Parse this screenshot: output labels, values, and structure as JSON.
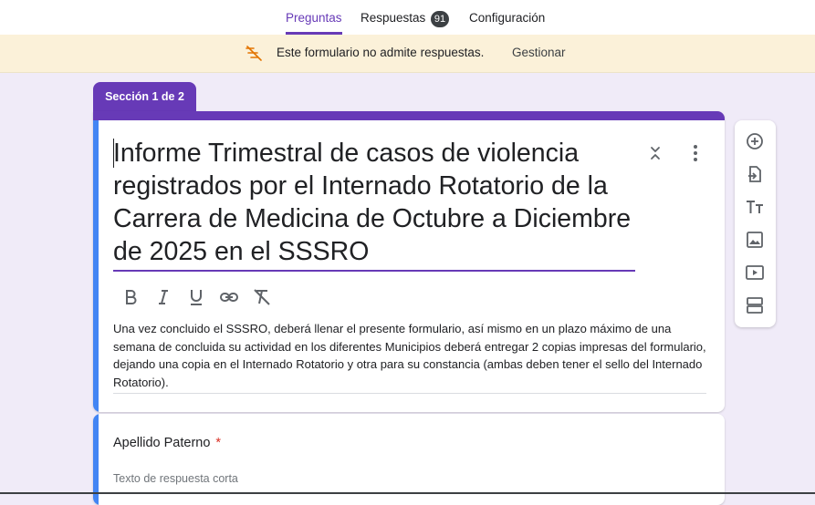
{
  "tabs": [
    {
      "label": "Preguntas",
      "active": true
    },
    {
      "label": "Respuestas",
      "active": false,
      "badge": "91"
    },
    {
      "label": "Configuración",
      "active": false
    }
  ],
  "banner": {
    "icon": "no-responses-icon",
    "text": "Este formulario no admite respuestas.",
    "action_label": "Gestionar"
  },
  "section": {
    "label": "Sección 1 de 2"
  },
  "form": {
    "title": "Informe Trimestral de casos de violencia registrados por el Internado Rotatorio de la Carrera de Medicina de Octubre a Diciembre de 2025 en el SSSRO",
    "description": "Una vez concluido el SSSRO, deberá llenar el presente formulario, así mismo en un plazo máximo de una semana de concluida su actividad en los diferentes Municipios deberá entregar 2 copias impresas del formulario, dejando una copia en el Internado Rotatorio y otra para su constancia (ambas deben tener el sello del Internado Rotatorio).",
    "format_tools": [
      "bold-icon",
      "italic-icon",
      "underline-icon",
      "link-icon",
      "clear-format-icon"
    ]
  },
  "question": {
    "label": "Apellido Paterno",
    "required_mark": "*",
    "placeholder": "Texto de respuesta corta"
  },
  "side_tools": [
    "add-question-icon",
    "import-questions-icon",
    "add-title-icon",
    "add-image-icon",
    "add-video-icon",
    "add-section-icon"
  ],
  "colors": {
    "accent": "#673ab7",
    "background": "#f0ebf8",
    "banner": "#fbf1d9",
    "focus_bar": "#4285f4",
    "required": "#d93025"
  }
}
